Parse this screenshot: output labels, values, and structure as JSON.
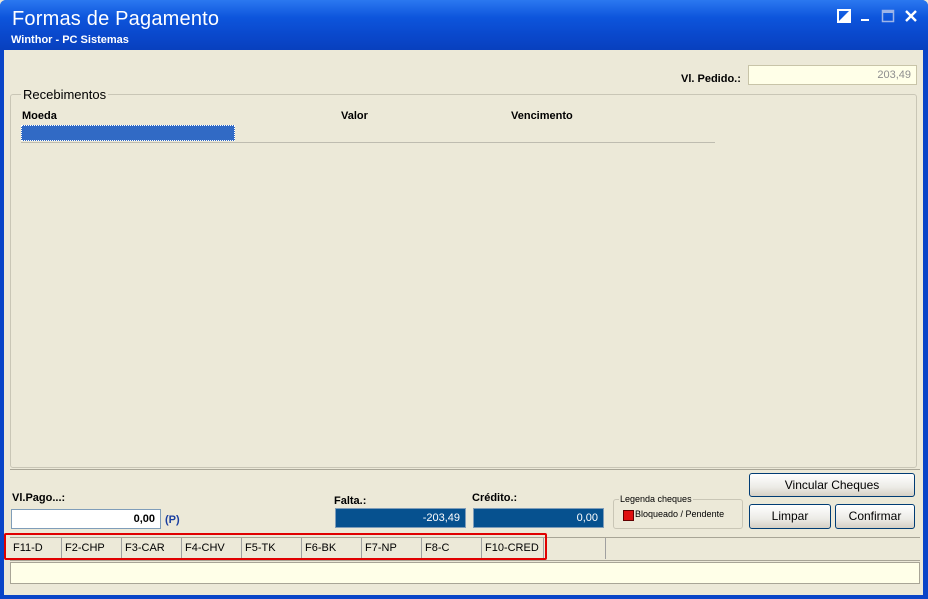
{
  "window": {
    "title": "Formas de Pagamento",
    "subtitle": "Winthor - PC Sistemas",
    "accent": "#0A48CC"
  },
  "pedido": {
    "label": "Vl. Pedido.:",
    "value": "203,49"
  },
  "recebimentos": {
    "title": "Recebimentos",
    "columns": [
      "Moeda",
      "Valor",
      "Vencimento"
    ]
  },
  "pago": {
    "label": "Vl.Pago...:",
    "value": "0,00",
    "suffix": "(P)"
  },
  "falta": {
    "label": "Falta.:",
    "value": "-203,49"
  },
  "credito": {
    "label": "Crédito.:",
    "value": "0,00"
  },
  "legenda": {
    "title": "Legenda cheques",
    "item": "Bloqueado / Pendente",
    "color": "#E01010"
  },
  "buttons": {
    "vincular": "Vincular Cheques",
    "limpar": "Limpar",
    "confirmar": "Confirmar"
  },
  "fkeys": [
    "F11-D",
    "F2-CHP",
    "F3-CAR",
    "F4-CHV",
    "F5-TK",
    "F6-BK",
    "F7-NP",
    "F8-C",
    "F10-CRED"
  ]
}
